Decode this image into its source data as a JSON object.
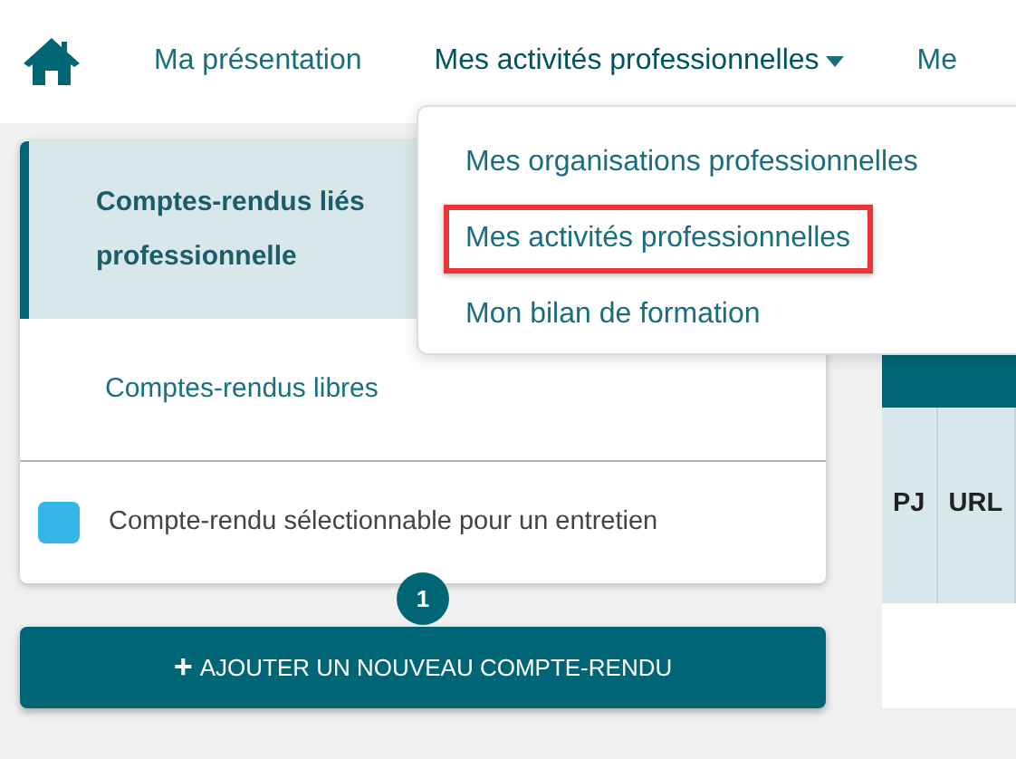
{
  "nav": {
    "items": [
      {
        "label": "Ma présentation",
        "dropdown": false,
        "selected": false
      },
      {
        "label": "Mes activités professionnelles",
        "dropdown": true,
        "selected": true
      },
      {
        "label": "Me",
        "dropdown": false,
        "selected": false
      }
    ]
  },
  "dropdown_menu": {
    "items": [
      {
        "label": "Mes organisations professionnelles",
        "highlighted": false
      },
      {
        "label": "Mes activités professionnelles",
        "highlighted": true
      },
      {
        "label": "Mon bilan de formation",
        "highlighted": false
      }
    ]
  },
  "sidebar": {
    "items": [
      {
        "lines": [
          "Comptes-rendus liés",
          "professionnelle"
        ],
        "selected": true
      },
      {
        "lines": [
          "Comptes-rendus libres"
        ],
        "selected": false
      }
    ],
    "legend": {
      "label": "Compte-rendu sélectionnable pour un entretien",
      "color": "#33b5e5"
    }
  },
  "badge": "1",
  "add_button": {
    "icon": "+",
    "label": "AJOUTER UN NOUVEAU COMPTE-RENDU"
  },
  "table": {
    "columns": [
      "PJ",
      "URL"
    ]
  }
}
